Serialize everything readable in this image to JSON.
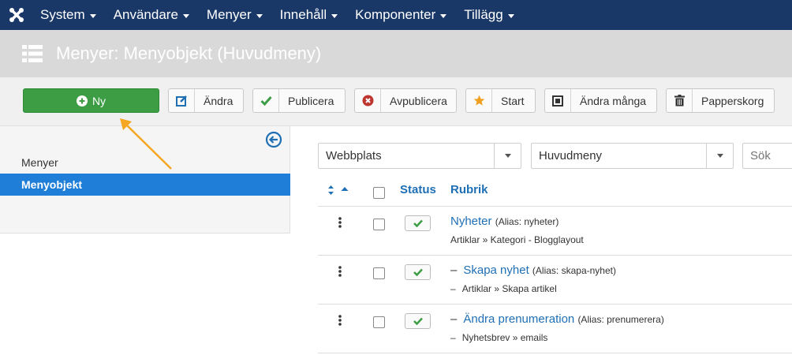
{
  "nav": {
    "logo_icon": "joomla-logo",
    "items": [
      {
        "label": "System"
      },
      {
        "label": "Användare"
      },
      {
        "label": "Menyer"
      },
      {
        "label": "Innehåll"
      },
      {
        "label": "Komponenter"
      },
      {
        "label": "Tillägg"
      }
    ]
  },
  "header": {
    "icon": "list-icon",
    "title": "Menyer: Menyobjekt (Huvudmeny)"
  },
  "toolbar": {
    "new_label": "Ny",
    "edit_label": "Ändra",
    "publish_label": "Publicera",
    "unpublish_label": "Avpublicera",
    "home_label": "Start",
    "batch_label": "Ändra många",
    "trash_label": "Papperskorg"
  },
  "sidebar": {
    "items": [
      {
        "label": "Menyer"
      },
      {
        "label": "Menyobjekt"
      }
    ]
  },
  "filters": {
    "client": "Webbplats",
    "menu": "Huvudmeny",
    "search_placeholder": "Sök"
  },
  "table": {
    "col_status": "Status",
    "col_title": "Rubrik",
    "rows": [
      {
        "dash": "",
        "title": "Nyheter",
        "alias": "(Alias: nyheter)",
        "type": "Artiklar » Kategori - Blogglayout",
        "status": "published"
      },
      {
        "dash": "–",
        "title": "Skapa nyhet",
        "alias": "(Alias: skapa-nyhet)",
        "type": "Artiklar » Skapa artikel",
        "status": "published"
      },
      {
        "dash": "–",
        "title": "Ändra prenumeration",
        "alias": "(Alias: prenumerera)",
        "type": "Nyhetsbrev » emails",
        "status": "published"
      }
    ]
  },
  "colors": {
    "navbar": "#1a3867",
    "header": "#d9d9d9",
    "new_button": "#3c9d45",
    "active_sidebar": "#1f7ed7",
    "link": "#1f6fb5",
    "annotation_arrow": "#f5a623"
  }
}
